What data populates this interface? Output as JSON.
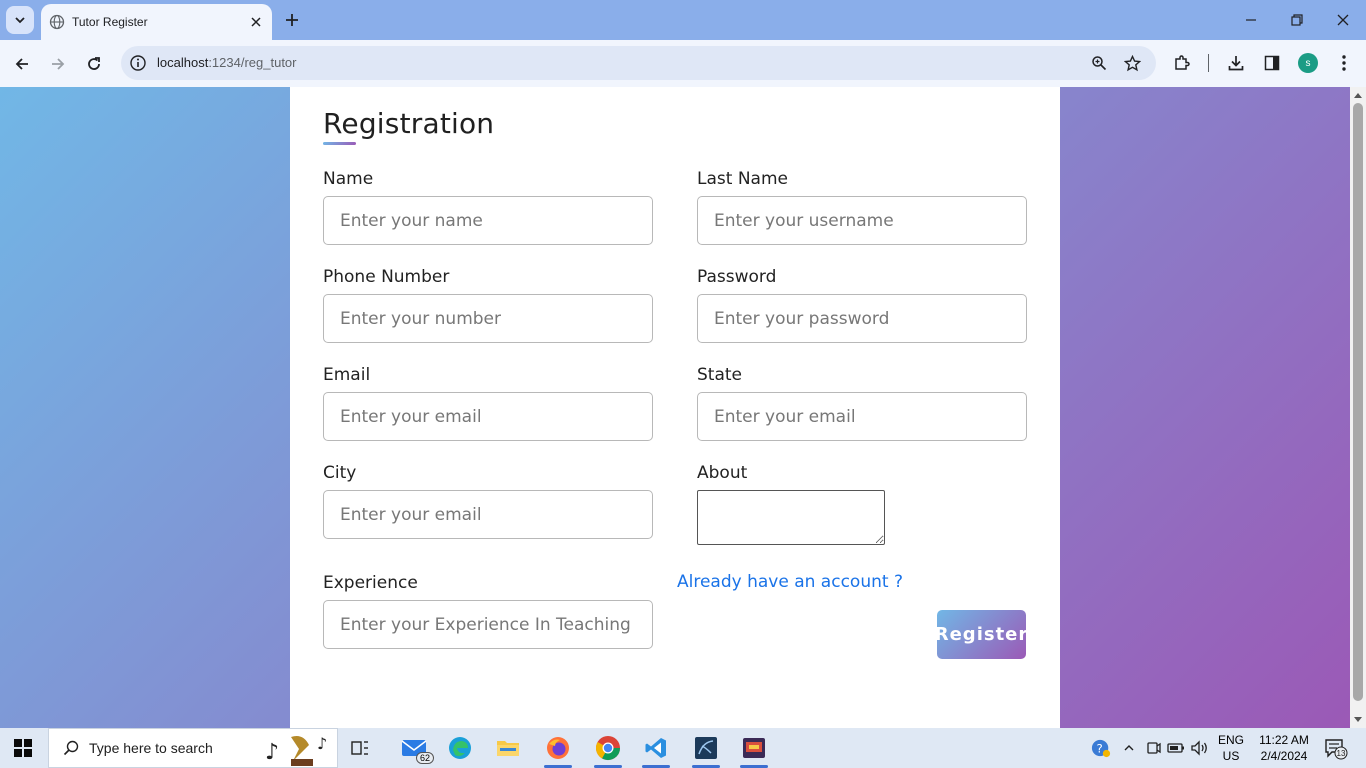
{
  "browser": {
    "tab_title": "Tutor Register",
    "url_host": "localhost",
    "url_path": ":1234/reg_tutor",
    "profile_initial": "s"
  },
  "form": {
    "title": "Registration",
    "fields": [
      {
        "label": "Name",
        "placeholder": "Enter your name"
      },
      {
        "label": "Last Name",
        "placeholder": "Enter your username"
      },
      {
        "label": "Phone Number",
        "placeholder": "Enter your number"
      },
      {
        "label": "Password",
        "placeholder": "Enter your password"
      },
      {
        "label": "Email",
        "placeholder": "Enter your email"
      },
      {
        "label": "State",
        "placeholder": "Enter your email"
      },
      {
        "label": "City",
        "placeholder": "Enter your email"
      },
      {
        "label": "About",
        "placeholder": ""
      },
      {
        "label": "Experience",
        "placeholder": "Enter your Experience In Teaching"
      }
    ],
    "login_link": "Already have an account ?",
    "register_label": "Register"
  },
  "taskbar": {
    "search_text": "Type here to search",
    "mail_badge": "62",
    "language": "ENG",
    "region": "US",
    "time": "11:22 AM",
    "date": "2/4/2024",
    "notification_count": "13"
  },
  "colors": {
    "gradient_start": "#71b7e6",
    "gradient_end": "#9b59b6",
    "link": "#1a73e8"
  }
}
